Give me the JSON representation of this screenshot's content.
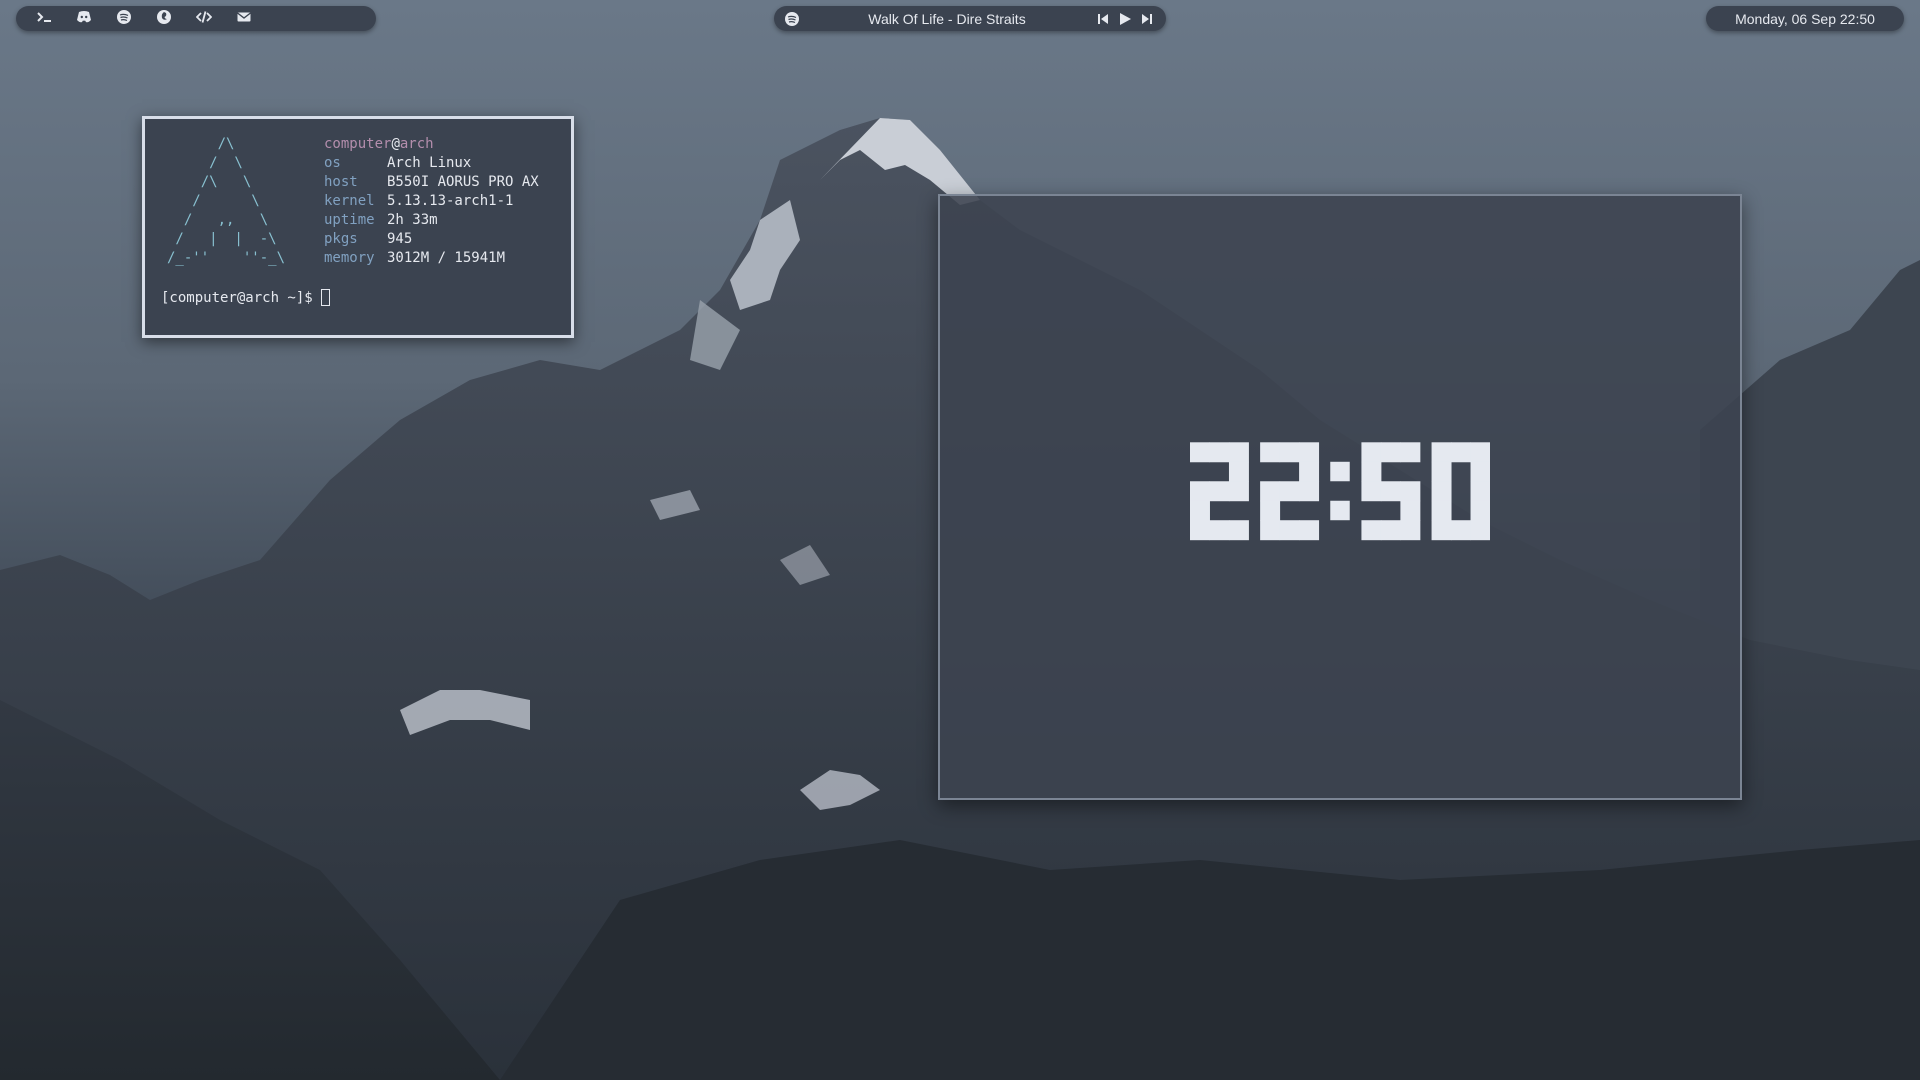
{
  "topbar": {
    "launcher": [
      {
        "icon": "terminal-icon"
      },
      {
        "icon": "discord-icon"
      },
      {
        "icon": "spotify-icon"
      },
      {
        "icon": "firefox-icon"
      },
      {
        "icon": "code-icon"
      },
      {
        "icon": "mail-icon"
      }
    ],
    "player": {
      "icon": "spotify-icon",
      "track": "Walk Of Life - Dire Straits",
      "controls": [
        "previous-icon",
        "play-icon",
        "next-icon"
      ]
    },
    "datetime": "Monday, 06 Sep 22:50"
  },
  "terminal": {
    "user": "computer",
    "at": "@",
    "host": "arch",
    "info": [
      {
        "key": "os",
        "value": "Arch Linux"
      },
      {
        "key": "host",
        "value": "B550I AORUS PRO AX"
      },
      {
        "key": "kernel",
        "value": "5.13.13-arch1-1"
      },
      {
        "key": "uptime",
        "value": "2h 33m"
      },
      {
        "key": "pkgs",
        "value": "945"
      },
      {
        "key": "memory",
        "value": "3012M / 15941M"
      }
    ],
    "ascii_art": "      /\\\n     /  \\\n    /\\   \\\n   /      \\\n  /   ,,   \\\n /   |  |  -\\\n/_-''    ''-_\\",
    "prompt": "[computer@arch ~]$"
  },
  "clock_widget": {
    "time": "22:50"
  },
  "colors": {
    "bar_bg": "#3b4350",
    "text": "#e6e9ef",
    "accent_blue": "#81a1c1",
    "accent_cyan": "#88c0d0",
    "accent_purple": "#b48ead"
  }
}
